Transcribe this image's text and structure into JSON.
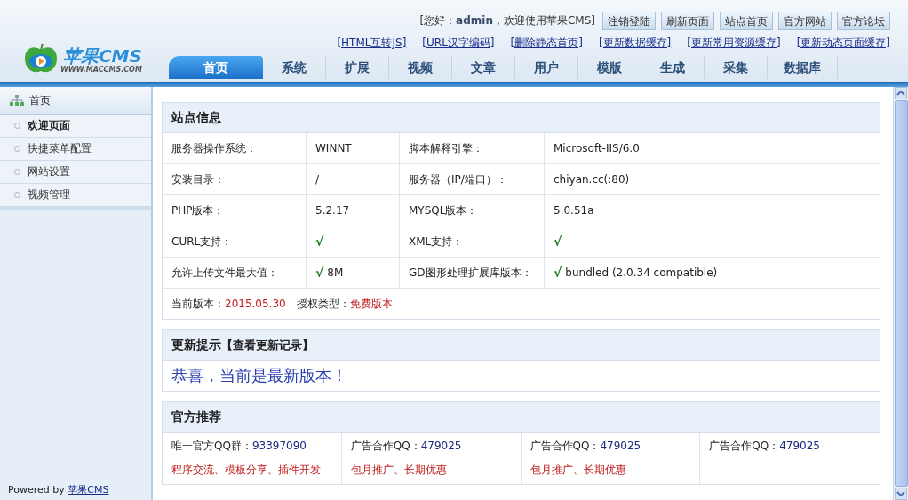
{
  "logo": {
    "name": "苹果CMS",
    "url": "WWW.MACCMS.COM"
  },
  "greeting": {
    "prefix": "[您好：",
    "user": "admin",
    "suffix": "，欢迎使用苹果CMS]"
  },
  "top_buttons": [
    "注销登陆",
    "刷新页面",
    "站点首页",
    "官方网站",
    "官方论坛"
  ],
  "quick_links": [
    "[HTML互转JS]",
    "[URL汉字编码]",
    "[删除静态首页]",
    "[更新数据缓存]",
    "[更新常用资源缓存]",
    "[更新动态页面缓存]"
  ],
  "tabs": [
    {
      "label": "首页",
      "selected": true
    },
    {
      "label": "系统",
      "selected": false
    },
    {
      "label": "扩展",
      "selected": false
    },
    {
      "label": "视频",
      "selected": false
    },
    {
      "label": "文章",
      "selected": false
    },
    {
      "label": "用户",
      "selected": false
    },
    {
      "label": "模版",
      "selected": false
    },
    {
      "label": "生成",
      "selected": false
    },
    {
      "label": "采集",
      "selected": false
    },
    {
      "label": "数据库",
      "selected": false
    }
  ],
  "sidebar": {
    "title": "首页",
    "items": [
      {
        "label": "欢迎页面",
        "selected": true
      },
      {
        "label": "快捷菜单配置",
        "selected": false
      },
      {
        "label": "网站设置",
        "selected": false
      },
      {
        "label": "视频管理",
        "selected": false
      }
    ],
    "footer_prefix": "Powered by ",
    "footer_link": "苹果CMS"
  },
  "site_info": {
    "title": "站点信息",
    "rows": [
      {
        "label_1": "服务器操作系统：",
        "value_1": {
          "text": "WINNT"
        },
        "label_2": "脚本解释引擎：",
        "value_2": {
          "text": "Microsoft-IIS/6.0"
        }
      },
      {
        "label_1": "安装目录：",
        "value_1": {
          "text": "/"
        },
        "label_2": "服务器（IP/端口）：",
        "value_2": {
          "text": "chiyan.cc(:80)"
        }
      },
      {
        "label_1": "PHP版本：",
        "value_1": {
          "text": "5.2.17"
        },
        "label_2": "MYSQL版本：",
        "value_2": {
          "text": "5.0.51a"
        }
      },
      {
        "label_1": "CURL支持：",
        "value_1": {
          "check": "√"
        },
        "label_2": "XML支持：",
        "value_2": {
          "check": "√"
        }
      },
      {
        "label_1": "允许上传文件最大值：",
        "value_1": {
          "check": "√",
          "text": "8M"
        },
        "label_2": "GD图形处理扩展库版本：",
        "value_2": {
          "check": "√",
          "text": "bundled (2.0.34 compatible)"
        }
      }
    ],
    "version_label": "当前版本：",
    "version": "2015.05.30",
    "license_label": "授权类型：",
    "license": "免费版本"
  },
  "update": {
    "title": "更新提示",
    "link": "【查看更新记录】",
    "message": "恭喜，当前是最新版本！"
  },
  "recommend": {
    "title": "官方推荐",
    "items": [
      {
        "label": "唯一官方QQ群：",
        "value": "93397090",
        "note": "程序交流、模板分享、插件开发"
      },
      {
        "label": "广告合作QQ：",
        "value": "479025",
        "note": "包月推广、长期优惠"
      },
      {
        "label": "广告合作QQ：",
        "value": "479025",
        "note": "包月推广、长期优惠"
      },
      {
        "label": "广告合作QQ：",
        "value": "479025"
      }
    ]
  }
}
